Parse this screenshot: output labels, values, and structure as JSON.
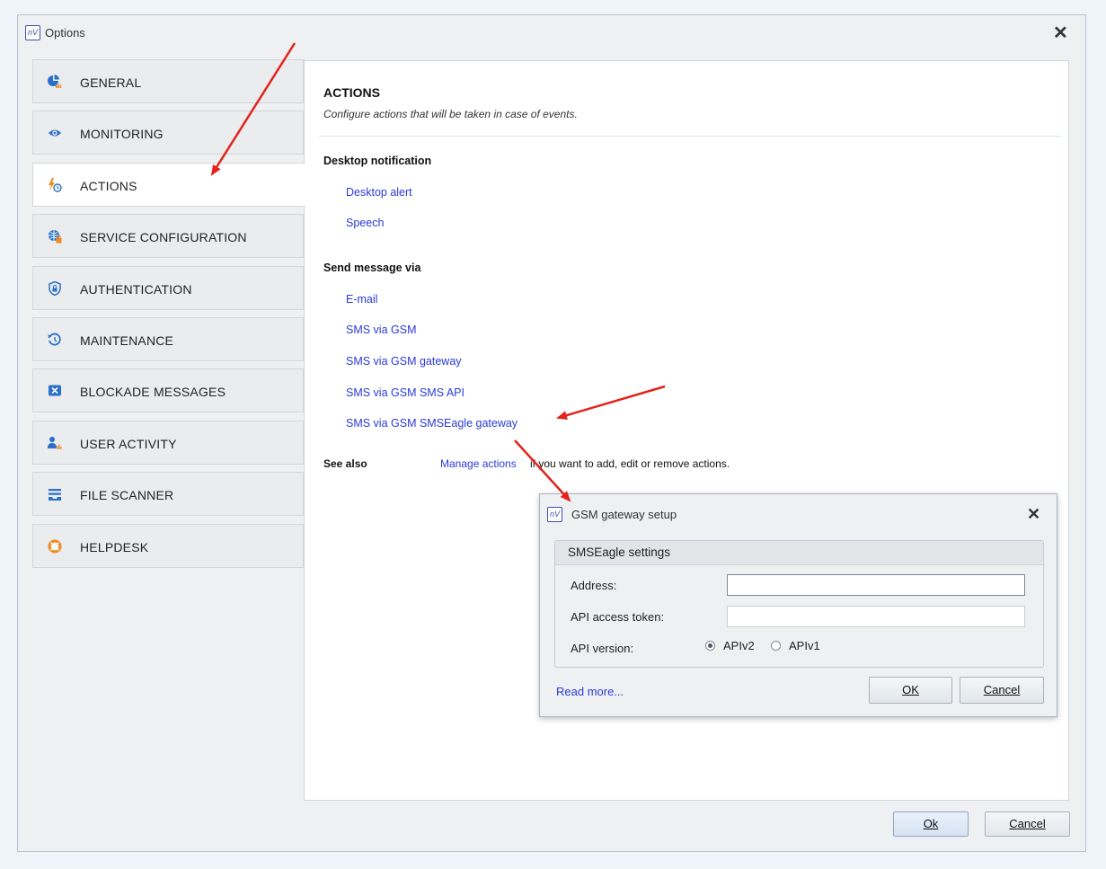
{
  "window": {
    "app_icon_text": "nV",
    "title": "Options",
    "close_glyph": "✕"
  },
  "sidebar": {
    "items": [
      {
        "label": "GENERAL",
        "icon": "pie-chart-icon",
        "active": false
      },
      {
        "label": "MONITORING",
        "icon": "eye-icon",
        "active": false
      },
      {
        "label": "ACTIONS",
        "icon": "lightning-clock-icon",
        "active": true
      },
      {
        "label": "SERVICE CONFIGURATION",
        "icon": "globe-lock-icon",
        "active": false
      },
      {
        "label": "AUTHENTICATION",
        "icon": "shield-lock-icon",
        "active": false
      },
      {
        "label": "MAINTENANCE",
        "icon": "restore-clock-icon",
        "active": false
      },
      {
        "label": "BLOCKADE MESSAGES",
        "icon": "blocked-message-icon",
        "active": false
      },
      {
        "label": "USER ACTIVITY",
        "icon": "user-activity-icon",
        "active": false
      },
      {
        "label": "FILE SCANNER",
        "icon": "tray-icon",
        "active": false
      },
      {
        "label": "HELPDESK",
        "icon": "lifebuoy-icon",
        "active": false
      }
    ]
  },
  "content": {
    "title": "ACTIONS",
    "subtitle": "Configure actions that will be taken in case of events.",
    "desktop_group": {
      "heading": "Desktop notification",
      "links": [
        "Desktop alert",
        "Speech"
      ]
    },
    "message_group": {
      "heading": "Send message via",
      "links": [
        "E-mail",
        "SMS via GSM",
        "SMS via GSM gateway",
        "SMS via GSM SMS API",
        "SMS via GSM SMSEagle gateway"
      ]
    },
    "see_also": {
      "label": "See also",
      "link": "Manage actions",
      "suffix": "if you want to add, edit or remove actions."
    }
  },
  "footer": {
    "ok_label": "Ok",
    "cancel_label": "Cancel"
  },
  "gsm_dialog": {
    "icon_text": "nV",
    "title": "GSM gateway setup",
    "close_glyph": "✕",
    "fieldset_title": "SMSEagle settings",
    "address_label": "Address:",
    "address_value": "",
    "token_label": "API access token:",
    "token_value": "",
    "version_label": "API version:",
    "version_options": [
      "APIv2",
      "APIv1"
    ],
    "version_selected": "APIv2",
    "read_more": "Read more...",
    "ok_label": "OK",
    "cancel_label": "Cancel"
  },
  "colors": {
    "link": "#2a3ad6",
    "annotation_arrow": "#e3221c",
    "accent_orange": "#f08a1c",
    "accent_blue": "#2a6fc9"
  }
}
